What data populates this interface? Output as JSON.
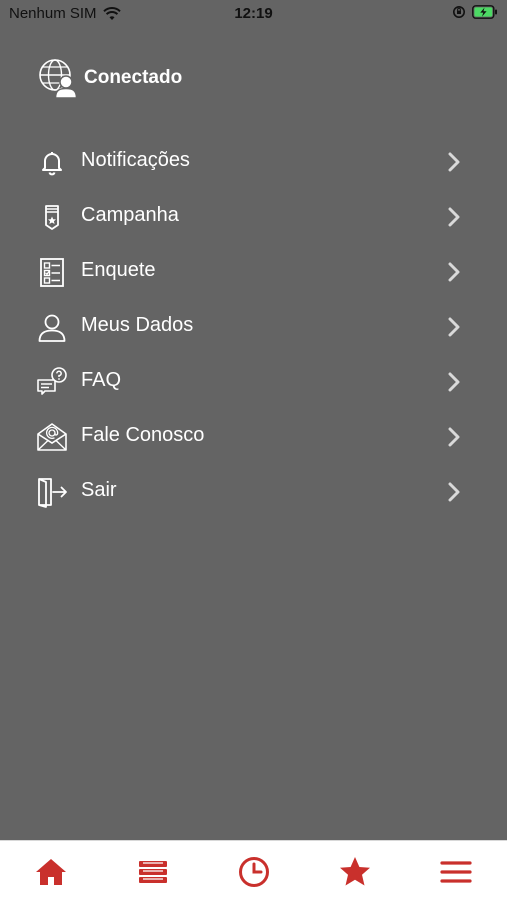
{
  "status_bar": {
    "carrier": "Nenhum SIM",
    "time": "12:19"
  },
  "header": {
    "title": "Conectado",
    "icon": "globe-user-icon"
  },
  "menu": {
    "items": [
      {
        "label": "Notificações",
        "icon": "bell-icon"
      },
      {
        "label": "Campanha",
        "icon": "badge-icon"
      },
      {
        "label": "Enquete",
        "icon": "checklist-icon"
      },
      {
        "label": "Meus Dados",
        "icon": "user-icon"
      },
      {
        "label": "FAQ",
        "icon": "faq-chat-icon"
      },
      {
        "label": "Fale Conosco",
        "icon": "email-icon"
      },
      {
        "label": "Sair",
        "icon": "logout-icon"
      }
    ]
  },
  "tabbar": {
    "tabs": [
      {
        "icon": "home-icon"
      },
      {
        "icon": "books-icon"
      },
      {
        "icon": "clock-icon"
      },
      {
        "icon": "star-icon"
      },
      {
        "icon": "menu-icon"
      }
    ]
  },
  "colors": {
    "background": "#646464",
    "accent": "#c9302c",
    "text": "#ffffff",
    "battery": "#4cd964"
  }
}
